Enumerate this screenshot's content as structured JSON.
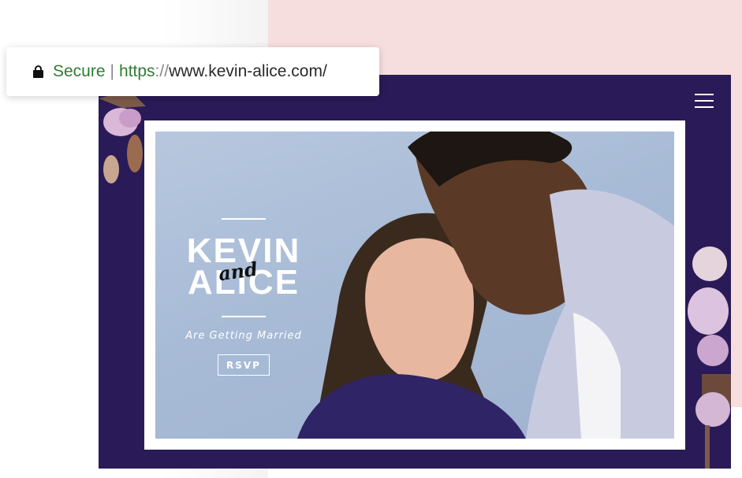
{
  "browser": {
    "secure_label": "Secure",
    "separator": "|",
    "scheme": "https",
    "scheme_sep": "://",
    "host_path": "www.kevin-alice.com/"
  },
  "site": {
    "hero": {
      "name_top": "KEVIN",
      "connector": "and",
      "name_bottom": "ALICE",
      "tagline": "Are Getting Married",
      "rsvp_label": "RSVP"
    }
  },
  "colors": {
    "site_background": "#2a1a57",
    "pink_panel": "#f7dede",
    "secure_green": "#2e7d32",
    "photo_sky": "#a8bbd6"
  },
  "icons": {
    "lock": "lock-icon",
    "menu": "hamburger-menu-icon"
  }
}
